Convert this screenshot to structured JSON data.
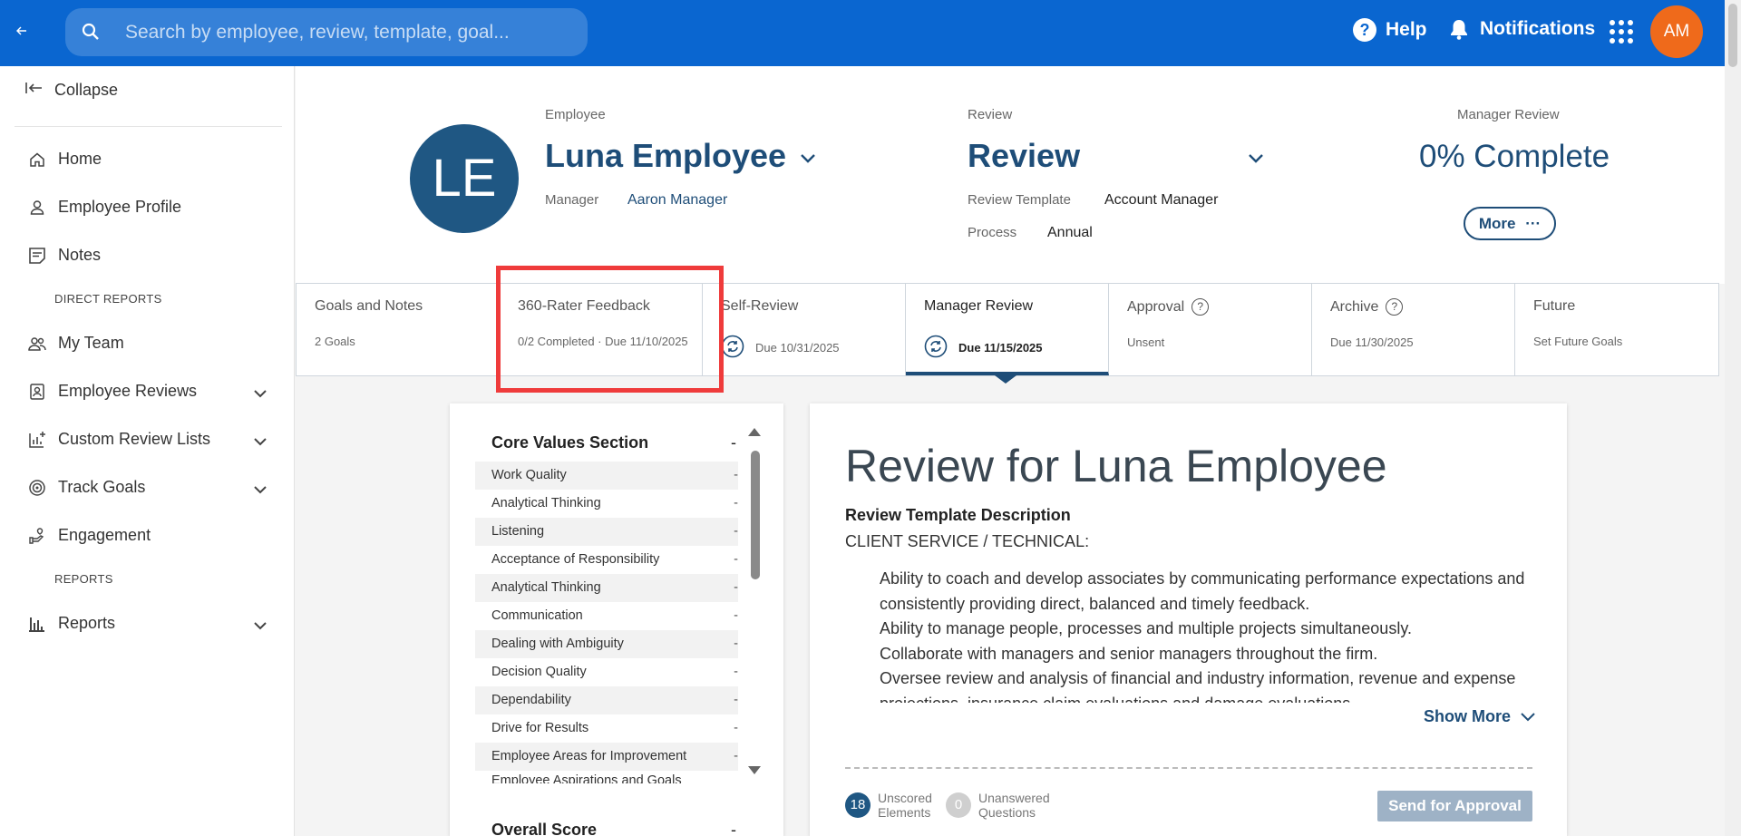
{
  "topbar": {
    "search_placeholder": "Search by employee, review, template, goal...",
    "help_label": "Help",
    "notifications_label": "Notifications",
    "user_initials": "AM",
    "brand_color": "#0a66d0",
    "avatar_color": "#ef6a1b"
  },
  "sidebar": {
    "collapse_label": "Collapse",
    "items": {
      "home": "Home",
      "employee_profile": "Employee Profile",
      "notes": "Notes",
      "direct_reports_header": "DIRECT REPORTS",
      "my_team": "My Team",
      "employee_reviews": "Employee Reviews",
      "custom_review_lists": "Custom Review Lists",
      "track_goals": "Track Goals",
      "engagement": "Engagement",
      "reports_header": "REPORTS",
      "reports": "Reports"
    }
  },
  "header": {
    "employee_label": "Employee",
    "employee_initials": "LE",
    "employee_name": "Luna Employee",
    "manager_label": "Manager",
    "manager_name": "Aaron Manager",
    "review_label": "Review",
    "review_name": "Review",
    "review_template_label": "Review Template",
    "review_template_value": "Account Manager",
    "process_label": "Process",
    "process_value": "Annual",
    "manager_review_label": "Manager Review",
    "percent_complete": "0% Complete",
    "more_button": "More"
  },
  "tabs": [
    {
      "title": "Goals and Notes",
      "subtitle": "2 Goals"
    },
    {
      "title": "360-Rater Feedback",
      "subtitle": "0/2 Completed · Due 11/10/2025"
    },
    {
      "title": "Self-Review",
      "subtitle": "Due 10/31/2025"
    },
    {
      "title": "Manager Review",
      "subtitle": "Due 11/15/2025"
    },
    {
      "title": "Approval",
      "subtitle": "Unsent"
    },
    {
      "title": "Archive",
      "subtitle": "Due 11/30/2025"
    },
    {
      "title": "Future",
      "subtitle": "Set Future Goals"
    }
  ],
  "outline": {
    "section_title": "Core Values Section",
    "section_dash": "-",
    "items": [
      "Work Quality",
      "Analytical Thinking",
      "Listening",
      "Acceptance of Responsibility",
      "Analytical Thinking",
      "Communication",
      "Dealing with Ambiguity",
      "Decision Quality",
      "Dependability",
      "Drive for Results",
      "Employee Areas for Improvement",
      "Employee Aspirations and Goals"
    ],
    "item_dash": "-",
    "overall_title": "Overall Score",
    "overall_dash": "-"
  },
  "review_card": {
    "title": "Review for Luna Employee",
    "desc_title": "Review Template Description",
    "desc_subtitle": "CLIENT SERVICE / TECHNICAL:",
    "bullets": [
      "Ability to coach and develop associates by communicating performance expectations and consistently providing direct, balanced and timely feedback.",
      "Ability to manage people, processes and multiple projects simultaneously.",
      "Collaborate with managers and senior managers throughout the firm.",
      "Oversee review and analysis of financial and industry information, revenue and expense projections, insurance claim evaluations and damage evaluations."
    ],
    "show_more": "Show More",
    "unscored_count": "18",
    "unscored_label_1": "Unscored",
    "unscored_label_2": "Elements",
    "unanswered_count": "0",
    "unanswered_label_1": "Unanswered",
    "unanswered_label_2": "Questions",
    "send_button": "Send for Approval"
  }
}
